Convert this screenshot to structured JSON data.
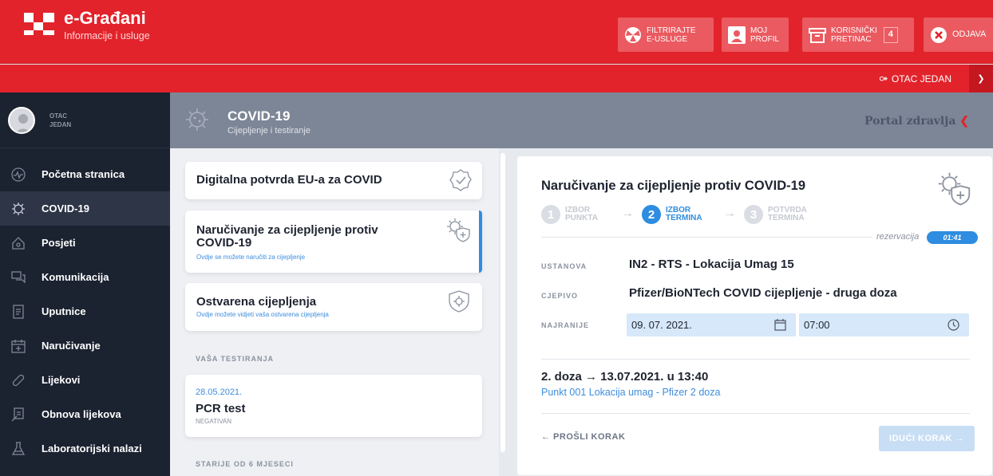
{
  "brand": {
    "title": "e-Građani",
    "subtitle": "Informacije i usluge"
  },
  "topbar": {
    "filter_l1": "FILTRIRAJTE",
    "filter_l2": "E-USLUGE",
    "profile_l1": "MOJ",
    "profile_l2": "PROFIL",
    "inbox_l1": "KORISNIČKI",
    "inbox_l2": "PRETINAC",
    "inbox_count": "4",
    "logout": "ODJAVA"
  },
  "user": {
    "name": "OTAC JEDAN",
    "side_first": "OTAC",
    "side_last": "JEDAN"
  },
  "sidebar": {
    "items": [
      {
        "label": "Početna stranica",
        "icon": "wave-icon"
      },
      {
        "label": "COVID-19",
        "icon": "virus-icon"
      },
      {
        "label": "Posjeti",
        "icon": "home-icon"
      },
      {
        "label": "Komunikacija",
        "icon": "chat-icon"
      },
      {
        "label": "Uputnice",
        "icon": "document-icon"
      },
      {
        "label": "Naručivanje",
        "icon": "calendar-plus-icon"
      },
      {
        "label": "Lijekovi",
        "icon": "pill-icon"
      },
      {
        "label": "Obnova lijekova",
        "icon": "prescription-icon"
      },
      {
        "label": "Laboratorijski nalazi",
        "icon": "flask-icon"
      }
    ]
  },
  "header": {
    "title": "COVID-19",
    "subtitle": "Cijepljenje i testiranje",
    "portal": "Portal zdravlja"
  },
  "cards": {
    "eu_cert": {
      "title": "Digitalna potvrda EU-a za COVID"
    },
    "booking": {
      "title_l1": "Naručivanje za cijepljenje protiv",
      "title_l2": "COVID-19",
      "sub": "Ovdje se možete naručiti za cijepljenje"
    },
    "done": {
      "title": "Ostvarena cijepljenja",
      "sub": "Ovdje možete vidjeti vaša ostvarena cijepljenja"
    }
  },
  "tests": {
    "section": "VAŠA TESTIRANJA",
    "items": [
      {
        "date": "28.05.2021.",
        "name": "PCR test",
        "result": "NEGATIVAN"
      }
    ],
    "older": "STARIJE OD 6 MJESECI"
  },
  "form": {
    "title": "Naručivanje za cijepljenje protiv COVID-19",
    "steps": [
      {
        "num": "1",
        "l1": "IZBOR",
        "l2": "PUNKTA"
      },
      {
        "num": "2",
        "l1": "IZBOR",
        "l2": "TERMINA"
      },
      {
        "num": "3",
        "l1": "POTVRDA",
        "l2": "TERMINA"
      }
    ],
    "reservation_label": "rezervacija",
    "timer": "01:41",
    "institution_label": "USTANOVA",
    "institution": "IN2 - RTS - Lokacija Umag 15",
    "vaccine_label": "CJEPIVO",
    "vaccine": "Pfizer/BioNTech COVID cijepljenje - druga doza",
    "earliest_label": "NAJRANIJE",
    "date": "09. 07. 2021.",
    "time": "07:00",
    "result_title": "2. doza → 13.07.2021. u 13:40",
    "result_sub": "Punkt 001 Lokacija umag - Pfizer 2 doza",
    "prev": "← PROŠLI KORAK",
    "next": "IDUĆI KORAK →"
  }
}
